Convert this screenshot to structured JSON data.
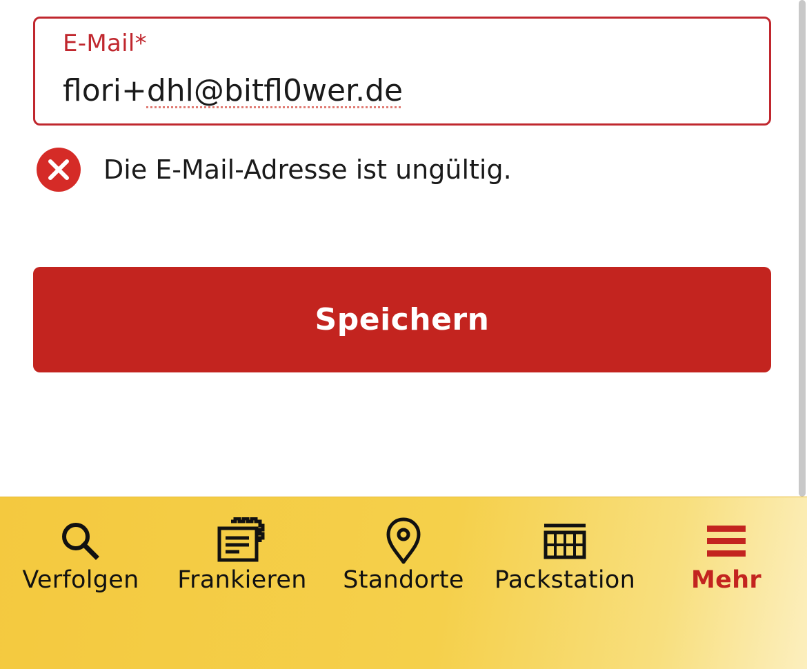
{
  "form": {
    "email_label": "E-Mail*",
    "email_value_prefix": "flori+",
    "email_value_misspelled": "dhl@bitfl0wer.de",
    "error_message": "Die E-Mail-Adresse ist ungültig.",
    "save_label": "Speichern"
  },
  "tabbar": {
    "items": [
      {
        "label": "Verfolgen",
        "icon": "search-icon"
      },
      {
        "label": "Frankieren",
        "icon": "stamp-icon"
      },
      {
        "label": "Standorte",
        "icon": "location-pin-icon"
      },
      {
        "label": "Packstation",
        "icon": "packstation-icon"
      },
      {
        "label": "Mehr",
        "icon": "menu-icon",
        "active": true
      }
    ]
  },
  "colors": {
    "brand_red": "#c3241f",
    "brand_yellow": "#f5cc43",
    "error_red": "#d52b27"
  }
}
